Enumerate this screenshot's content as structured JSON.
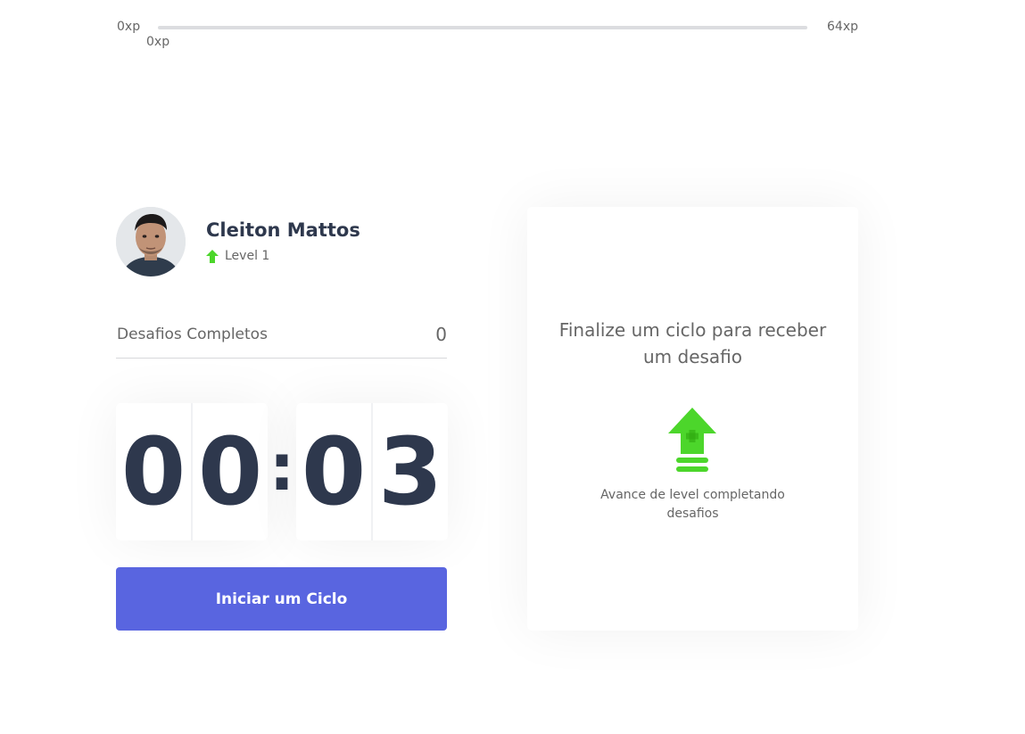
{
  "experience": {
    "min_label": "0xp",
    "max_label": "64xp",
    "current_label": "0xp",
    "progress_fraction": 0
  },
  "profile": {
    "name": "Cleiton Mattos",
    "level_label": "Level 1",
    "avatar_icon": "user-photo",
    "level_icon": "level-up-arrow-icon"
  },
  "completed_challenges": {
    "label": "Desafios Completos",
    "value": "0"
  },
  "countdown": {
    "minute_digits": [
      "0",
      "0"
    ],
    "separator": ":",
    "second_digits": [
      "0",
      "3"
    ]
  },
  "start_button": {
    "label": "Iniciar um Ciclo"
  },
  "challenge_box": {
    "title": "Finalize um ciclo para receber um desafio",
    "hint": "Avance de level completando desafios",
    "icon": "level-up-icon"
  },
  "colors": {
    "accent": "#5965e0",
    "level_green": "#4cd62b",
    "text": "#666666",
    "title": "#2e384d"
  }
}
